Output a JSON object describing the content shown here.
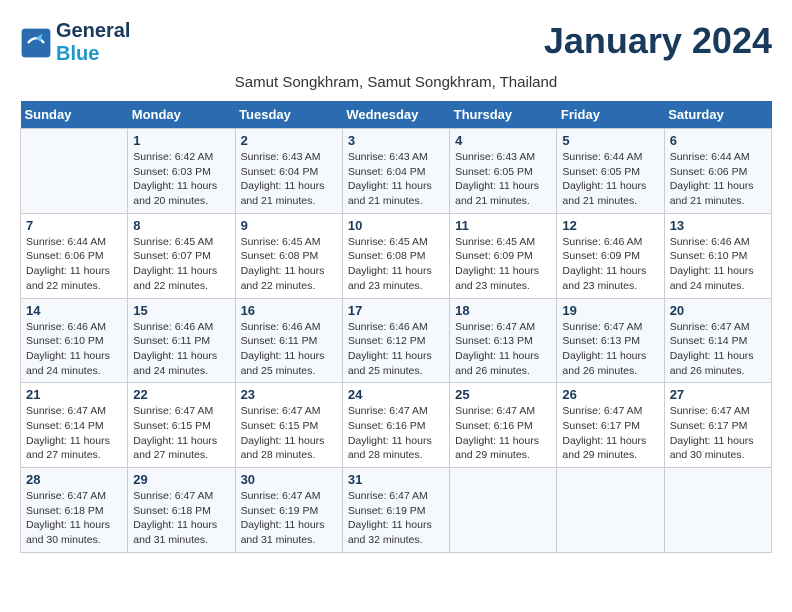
{
  "header": {
    "logo_line1": "General",
    "logo_line2": "Blue",
    "month": "January 2024",
    "location": "Samut Songkhram, Samut Songkhram, Thailand"
  },
  "weekdays": [
    "Sunday",
    "Monday",
    "Tuesday",
    "Wednesday",
    "Thursday",
    "Friday",
    "Saturday"
  ],
  "weeks": [
    [
      {
        "day": "",
        "info": ""
      },
      {
        "day": "1",
        "info": "Sunrise: 6:42 AM\nSunset: 6:03 PM\nDaylight: 11 hours\nand 20 minutes."
      },
      {
        "day": "2",
        "info": "Sunrise: 6:43 AM\nSunset: 6:04 PM\nDaylight: 11 hours\nand 21 minutes."
      },
      {
        "day": "3",
        "info": "Sunrise: 6:43 AM\nSunset: 6:04 PM\nDaylight: 11 hours\nand 21 minutes."
      },
      {
        "day": "4",
        "info": "Sunrise: 6:43 AM\nSunset: 6:05 PM\nDaylight: 11 hours\nand 21 minutes."
      },
      {
        "day": "5",
        "info": "Sunrise: 6:44 AM\nSunset: 6:05 PM\nDaylight: 11 hours\nand 21 minutes."
      },
      {
        "day": "6",
        "info": "Sunrise: 6:44 AM\nSunset: 6:06 PM\nDaylight: 11 hours\nand 21 minutes."
      }
    ],
    [
      {
        "day": "7",
        "info": "Sunrise: 6:44 AM\nSunset: 6:06 PM\nDaylight: 11 hours\nand 22 minutes."
      },
      {
        "day": "8",
        "info": "Sunrise: 6:45 AM\nSunset: 6:07 PM\nDaylight: 11 hours\nand 22 minutes."
      },
      {
        "day": "9",
        "info": "Sunrise: 6:45 AM\nSunset: 6:08 PM\nDaylight: 11 hours\nand 22 minutes."
      },
      {
        "day": "10",
        "info": "Sunrise: 6:45 AM\nSunset: 6:08 PM\nDaylight: 11 hours\nand 23 minutes."
      },
      {
        "day": "11",
        "info": "Sunrise: 6:45 AM\nSunset: 6:09 PM\nDaylight: 11 hours\nand 23 minutes."
      },
      {
        "day": "12",
        "info": "Sunrise: 6:46 AM\nSunset: 6:09 PM\nDaylight: 11 hours\nand 23 minutes."
      },
      {
        "day": "13",
        "info": "Sunrise: 6:46 AM\nSunset: 6:10 PM\nDaylight: 11 hours\nand 24 minutes."
      }
    ],
    [
      {
        "day": "14",
        "info": "Sunrise: 6:46 AM\nSunset: 6:10 PM\nDaylight: 11 hours\nand 24 minutes."
      },
      {
        "day": "15",
        "info": "Sunrise: 6:46 AM\nSunset: 6:11 PM\nDaylight: 11 hours\nand 24 minutes."
      },
      {
        "day": "16",
        "info": "Sunrise: 6:46 AM\nSunset: 6:11 PM\nDaylight: 11 hours\nand 25 minutes."
      },
      {
        "day": "17",
        "info": "Sunrise: 6:46 AM\nSunset: 6:12 PM\nDaylight: 11 hours\nand 25 minutes."
      },
      {
        "day": "18",
        "info": "Sunrise: 6:47 AM\nSunset: 6:13 PM\nDaylight: 11 hours\nand 26 minutes."
      },
      {
        "day": "19",
        "info": "Sunrise: 6:47 AM\nSunset: 6:13 PM\nDaylight: 11 hours\nand 26 minutes."
      },
      {
        "day": "20",
        "info": "Sunrise: 6:47 AM\nSunset: 6:14 PM\nDaylight: 11 hours\nand 26 minutes."
      }
    ],
    [
      {
        "day": "21",
        "info": "Sunrise: 6:47 AM\nSunset: 6:14 PM\nDaylight: 11 hours\nand 27 minutes."
      },
      {
        "day": "22",
        "info": "Sunrise: 6:47 AM\nSunset: 6:15 PM\nDaylight: 11 hours\nand 27 minutes."
      },
      {
        "day": "23",
        "info": "Sunrise: 6:47 AM\nSunset: 6:15 PM\nDaylight: 11 hours\nand 28 minutes."
      },
      {
        "day": "24",
        "info": "Sunrise: 6:47 AM\nSunset: 6:16 PM\nDaylight: 11 hours\nand 28 minutes."
      },
      {
        "day": "25",
        "info": "Sunrise: 6:47 AM\nSunset: 6:16 PM\nDaylight: 11 hours\nand 29 minutes."
      },
      {
        "day": "26",
        "info": "Sunrise: 6:47 AM\nSunset: 6:17 PM\nDaylight: 11 hours\nand 29 minutes."
      },
      {
        "day": "27",
        "info": "Sunrise: 6:47 AM\nSunset: 6:17 PM\nDaylight: 11 hours\nand 30 minutes."
      }
    ],
    [
      {
        "day": "28",
        "info": "Sunrise: 6:47 AM\nSunset: 6:18 PM\nDaylight: 11 hours\nand 30 minutes."
      },
      {
        "day": "29",
        "info": "Sunrise: 6:47 AM\nSunset: 6:18 PM\nDaylight: 11 hours\nand 31 minutes."
      },
      {
        "day": "30",
        "info": "Sunrise: 6:47 AM\nSunset: 6:19 PM\nDaylight: 11 hours\nand 31 minutes."
      },
      {
        "day": "31",
        "info": "Sunrise: 6:47 AM\nSunset: 6:19 PM\nDaylight: 11 hours\nand 32 minutes."
      },
      {
        "day": "",
        "info": ""
      },
      {
        "day": "",
        "info": ""
      },
      {
        "day": "",
        "info": ""
      }
    ]
  ]
}
